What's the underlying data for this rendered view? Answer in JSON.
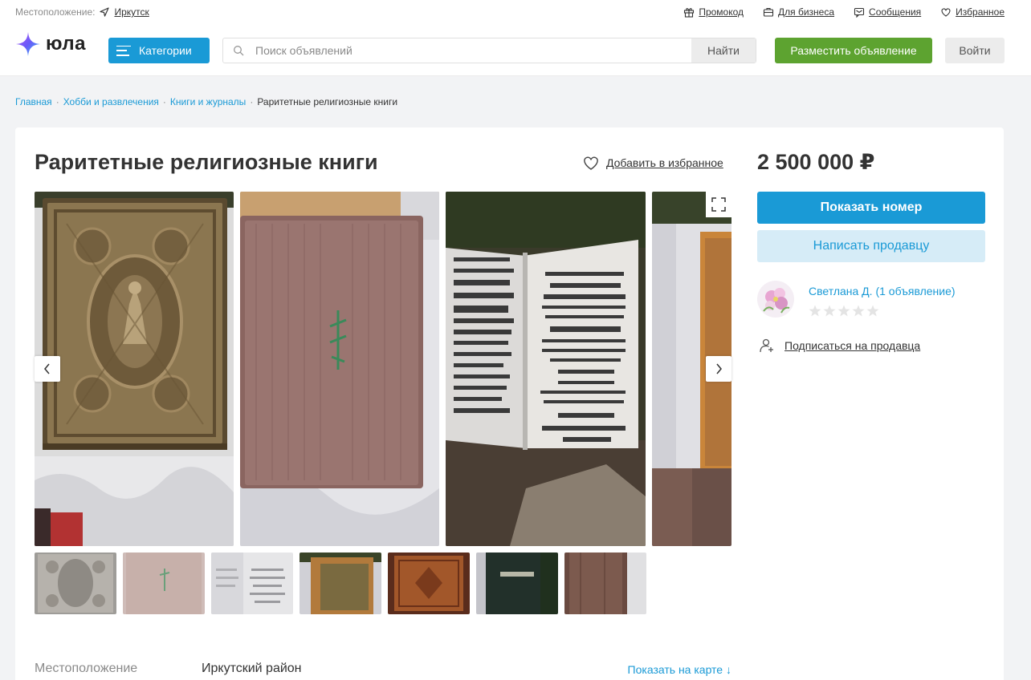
{
  "topbar": {
    "location_label": "Местоположение:",
    "location_city": "Иркутск",
    "links": [
      {
        "label": "Промокод",
        "icon": "gift-icon"
      },
      {
        "label": "Для бизнеса",
        "icon": "briefcase-icon"
      },
      {
        "label": "Сообщения",
        "icon": "message-icon"
      },
      {
        "label": "Избранное",
        "icon": "heart-icon"
      }
    ]
  },
  "header": {
    "logo_text": "юла",
    "categories_label": "Категории",
    "search_placeholder": "Поиск объявлений",
    "search_button": "Найти",
    "post_ad_button": "Разместить объявление",
    "login_button": "Войти"
  },
  "breadcrumbs": [
    "Главная",
    "Хобби и развлечения",
    "Книги и журналы",
    "Раритетные религиозные книги"
  ],
  "listing": {
    "title": "Раритетные религиозные книги",
    "favorite_label": "Добавить в избранное",
    "price": "2 500 000 ₽",
    "photo_count": 7
  },
  "actions": {
    "show_number": "Показать номер",
    "write_seller": "Написать продавцу",
    "subscribe": "Подписаться на продавца"
  },
  "seller": {
    "name": "Светлана Д. (1 объявление)",
    "rating": 0,
    "max_rating": 5
  },
  "details": {
    "location_label": "Местоположение",
    "location_value": "Иркутский район",
    "map_link": "Показать на карте ↓"
  },
  "colors": {
    "accent_blue": "#1a9ad6",
    "post_green": "#5da330",
    "light_blue": "#d6ecf7"
  }
}
